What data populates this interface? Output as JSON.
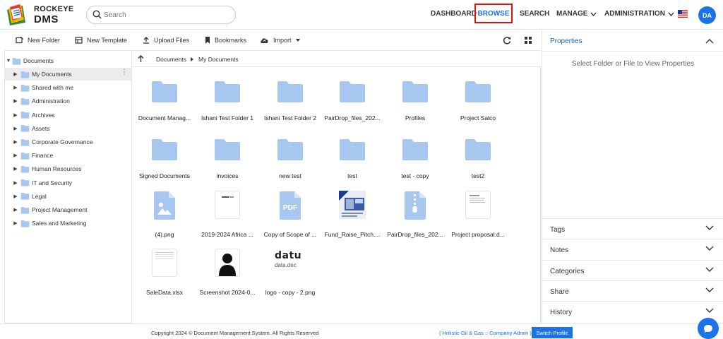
{
  "brand": {
    "line1": "ROCKEYE",
    "line2": "DMS"
  },
  "search": {
    "placeholder": "Search"
  },
  "nav": {
    "dashboard": "DASHBOARD",
    "browse": "BROWSE",
    "search": "SEARCH",
    "manage": "MANAGE",
    "administration": "ADMINISTRATION",
    "avatar": "DA"
  },
  "toolbar": {
    "new_folder": "New Folder",
    "new_template": "New Template",
    "upload_files": "Upload Files",
    "bookmarks": "Bookmarks",
    "import": "Import"
  },
  "tree": {
    "root": "Documents",
    "items": [
      "My Documents",
      "Shared with me",
      "Administration",
      "Archives",
      "Assets",
      "Corporate Governance",
      "Finance",
      "Human Resources",
      "IT and Security",
      "Legal",
      "Project Management",
      "Sales and Marketing"
    ]
  },
  "breadcrumb": {
    "root": "Documents",
    "current": "My Documents"
  },
  "files": {
    "row1": [
      "Document Manag...",
      "Ishani Test Folder 1",
      "Ishani Test Folder 2",
      "PairDrop_files_202...",
      "Profiles",
      "Project Salco"
    ],
    "row2": [
      "Signed Documents",
      "invoices",
      "new test",
      "test",
      "test - copy",
      "test2"
    ],
    "row3": [
      "(4).png",
      "2019-2024 Africa ...",
      "Copy of Scope of ...",
      "Fund_Raise_Pitch....",
      "PairDrop_files_202...",
      "Project proposal.d..."
    ],
    "row4": [
      "SaleData.xlsx",
      "Screenshot 2024-0...",
      "logo - copy - 2.png"
    ],
    "logo_thumb_line1": "datu",
    "logo_thumb_line2": "data.dec",
    "pdf_label": "PDF"
  },
  "properties": {
    "title": "Properties",
    "empty": "Select Folder or File to View Properties",
    "sections": [
      "Tags",
      "Notes",
      "Categories",
      "Share",
      "History"
    ]
  },
  "footer": {
    "copyright": "Copyright 2024 © Document Management System. All Rights Reserved",
    "company": "( Holistic Oil & Gas :: Company Admin )",
    "switch_profile": "Switch Profile"
  },
  "colors": {
    "accent": "#1a73e8",
    "folder": "#a8c7f0",
    "highlight_border": "#dd1111"
  }
}
